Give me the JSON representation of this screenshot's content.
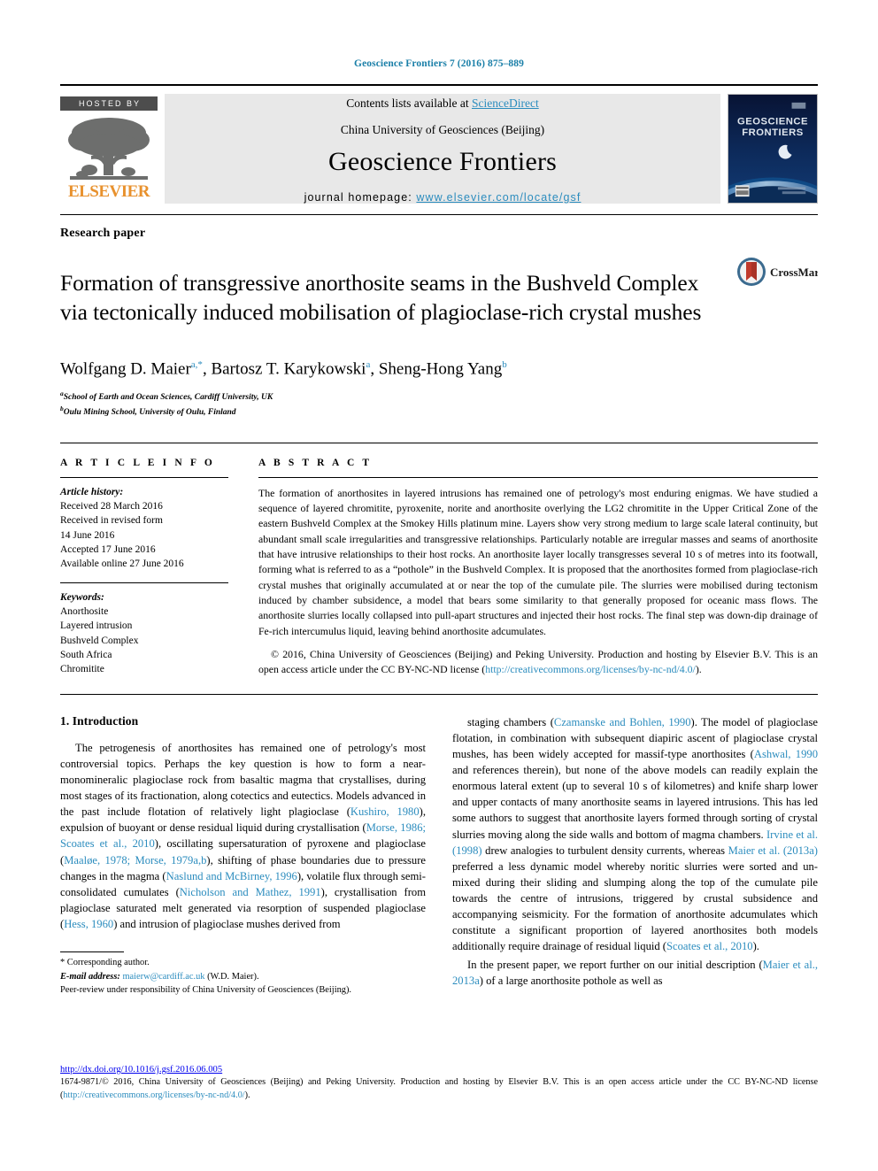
{
  "running_head": "Geoscience Frontiers 7 (2016) 875–889",
  "masthead": {
    "hosted_by": "HOSTED BY",
    "publisher_wordmark": "ELSEVIER",
    "contents_prefix": "Contents lists available at ",
    "contents_link": "ScienceDirect",
    "society": "China University of Geosciences (Beijing)",
    "journal_title": "Geoscience Frontiers",
    "homepage_label": "journal homepage: ",
    "homepage_url": "www.elsevier.com/locate/gsf",
    "cover": {
      "title_line1": "GEOSCIENCE",
      "title_line2": "FRONTIERS"
    }
  },
  "article": {
    "type": "Research paper",
    "title": "Formation of transgressive anorthosite seams in the Bushveld Complex via tectonically induced mobilisation of plagioclase-rich crystal mushes",
    "crossmark_label": "CrossMark",
    "authors_html": "Wolfgang D. Maier <sup>a,*</sup>, Bartosz T. Karykowski <sup>a</sup>, Sheng-Hong Yang <sup>b</sup>",
    "affiliations": [
      {
        "marker": "a",
        "text": "School of Earth and Ocean Sciences, Cardiff University, UK"
      },
      {
        "marker": "b",
        "text": "Oulu Mining School, University of Oulu, Finland"
      }
    ]
  },
  "article_info": {
    "heading": "A R T I C L E   I N F O",
    "history_label": "Article history:",
    "history_lines": [
      "Received 28 March 2016",
      "Received in revised form",
      "14 June 2016",
      "Accepted 17 June 2016",
      "Available online 27 June 2016"
    ],
    "keywords_label": "Keywords:",
    "keywords": [
      "Anorthosite",
      "Layered intrusion",
      "Bushveld Complex",
      "South Africa",
      "Chromitite"
    ]
  },
  "abstract": {
    "heading": "A B S T R A C T",
    "text": "The formation of anorthosites in layered intrusions has remained one of petrology's most enduring enigmas. We have studied a sequence of layered chromitite, pyroxenite, norite and anorthosite overlying the LG2 chromitite in the Upper Critical Zone of the eastern Bushveld Complex at the Smokey Hills platinum mine. Layers show very strong medium to large scale lateral continuity, but abundant small scale irregularities and transgressive relationships. Particularly notable are irregular masses and seams of anorthosite that have intrusive relationships to their host rocks. An anorthosite layer locally transgresses several 10 s of metres into its footwall, forming what is referred to as a “pothole” in the Bushveld Complex. It is proposed that the anorthosites formed from plagioclase-rich crystal mushes that originally accumulated at or near the top of the cumulate pile. The slurries were mobilised during tectonism induced by chamber subsidence, a model that bears some similarity to that generally proposed for oceanic mass flows. The anorthosite slurries locally collapsed into pull-apart structures and injected their host rocks. The final step was down-dip drainage of Fe-rich intercumulus liquid, leaving behind anorthosite adcumulates.",
    "copyright_prefix": "© 2016, China University of Geosciences (Beijing) and Peking University. Production and hosting by Elsevier B.V. This is an open access article under the CC BY-NC-ND license (",
    "copyright_link": "http://creativecommons.org/licenses/by-nc-nd/4.0/",
    "copyright_suffix": ")."
  },
  "body": {
    "section_title": "1.  Introduction",
    "left_paragraph_1": "The petrogenesis of anorthosites has remained one of petrology's most controversial topics. Perhaps the key question is how to form a near-monomineralic plagioclase rock from basaltic magma that crystallises, during most stages of its fractionation, along cotectics and eutectics. Models advanced in the past include flotation of relatively light plagioclase (Kushiro, 1980), expulsion of buoyant or dense residual liquid during crystallisation (Morse, 1986; Scoates et al., 2010), oscillating supersaturation of pyroxene and plagioclase (Maaløe, 1978; Morse, 1979a,b), shifting of phase boundaries due to pressure changes in the magma (Naslund and McBirney, 1996), volatile flux through semi-consolidated cumulates (Nicholson and Mathez, 1991), crystallisation from plagioclase saturated melt generated via resorption of suspended plagioclase (Hess, 1960) and intrusion of plagioclase mushes derived from",
    "right_paragraph_1": "staging chambers (Czamanske and Bohlen, 1990). The model of plagioclase flotation, in combination with subsequent diapiric ascent of plagioclase crystal mushes, has been widely accepted for massif-type anorthosites (Ashwal, 1990 and references therein), but none of the above models can readily explain the enormous lateral extent (up to several 10 s of kilometres) and knife sharp lower and upper contacts of many anorthosite seams in layered intrusions. This has led some authors to suggest that anorthosite layers formed through sorting of crystal slurries moving along the side walls and bottom of magma chambers. Irvine et al. (1998) drew analogies to turbulent density currents, whereas Maier et al. (2013a) preferred a less dynamic model whereby noritic slurries were sorted and un-mixed during their sliding and slumping along the top of the cumulate pile towards the centre of intrusions, triggered by crustal subsidence and accompanying seismicity. For the formation of anorthosite adcumulates which constitute a significant proportion of layered anorthosites both models additionally require drainage of residual liquid (Scoates et al., 2010).",
    "right_paragraph_2": "In the present paper, we report further on our initial description (Maier et al., 2013a) of a large anorthosite pothole as well as"
  },
  "footnotes": {
    "corresponding": "* Corresponding author.",
    "email_label": "E-mail address:",
    "email": "maierw@cardiff.ac.uk",
    "email_suffix": " (W.D. Maier).",
    "peer_review": "Peer-review under responsibility of China University of Geosciences (Beijing)."
  },
  "footer": {
    "doi": "http://dx.doi.org/10.1016/j.gsf.2016.06.005",
    "copyright_prefix": "1674-9871/© 2016, China University of Geosciences (Beijing) and Peking University. Production and hosting by Elsevier B.V. This is an open access article under the CC BY-NC-ND license (",
    "copyright_link": "http://creativecommons.org/licenses/by-nc-nd/4.0/",
    "copyright_suffix": ")."
  },
  "colors": {
    "link": "#2b8cbe",
    "elsevier_orange": "#e8912d",
    "band_gray": "#e8e8e8",
    "hosted_gray": "#4d4d4d"
  }
}
